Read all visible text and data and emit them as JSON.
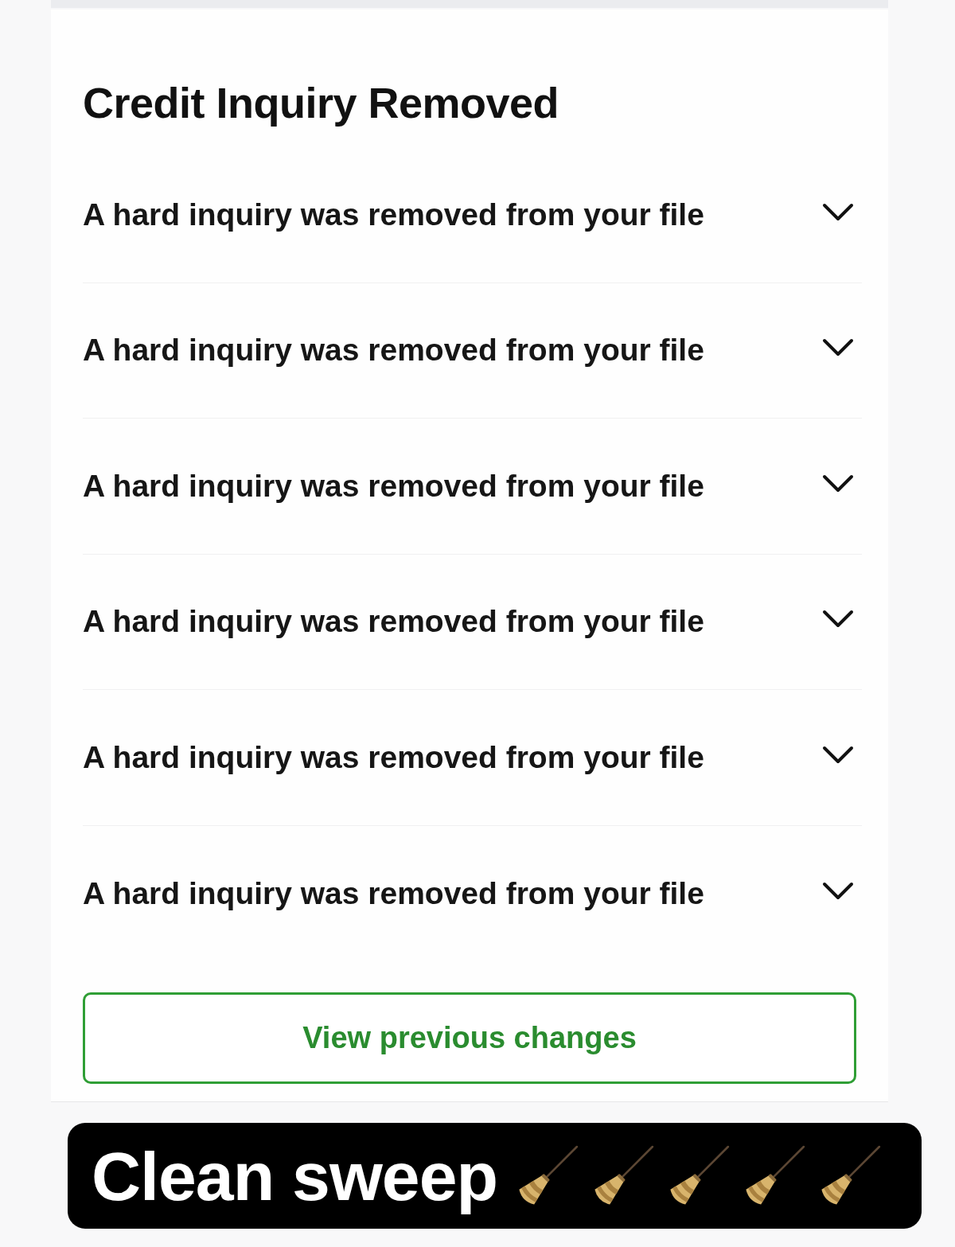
{
  "section": {
    "title": "Credit Inquiry Removed"
  },
  "rows": [
    {
      "label": "A hard inquiry was removed from your file",
      "expanded": false
    },
    {
      "label": "A hard inquiry was removed from your file",
      "expanded": false
    },
    {
      "label": "A hard inquiry was removed from your file",
      "expanded": false
    },
    {
      "label": "A hard inquiry was removed from your file",
      "expanded": false
    },
    {
      "label": "A hard inquiry was removed from your file",
      "expanded": false
    },
    {
      "label": "A hard inquiry was removed from your file",
      "expanded": false
    }
  ],
  "button": {
    "label": "View previous changes"
  },
  "caption": {
    "text": "Clean sweep",
    "decorations": [
      {
        "kind": "broom"
      },
      {
        "kind": "broom"
      },
      {
        "kind": "broom"
      },
      {
        "kind": "broom"
      },
      {
        "kind": "broom"
      }
    ]
  }
}
